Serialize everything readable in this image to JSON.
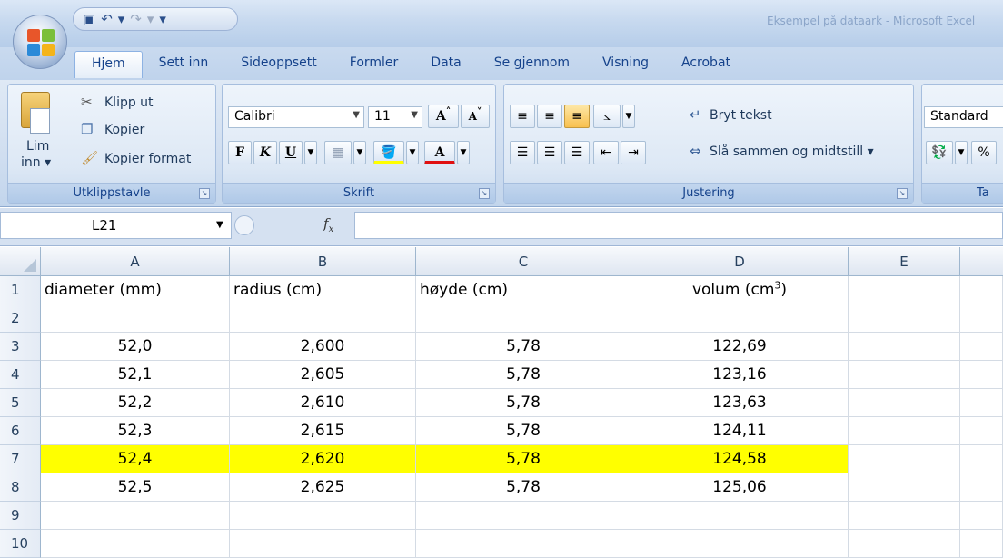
{
  "qat": {
    "undo_icon": "↶",
    "redo_icon": "↷",
    "dropdown": "▾"
  },
  "title_right": "Eksempel på dataark - Microsoft Excel",
  "tabs": [
    "Hjem",
    "Sett inn",
    "Sideoppsett",
    "Formler",
    "Data",
    "Se gjennom",
    "Visning",
    "Acrobat"
  ],
  "active_tab": "Hjem",
  "clipboard": {
    "paste_label": "Lim",
    "paste_label2": "inn ▾",
    "cut": "Klipp ut",
    "copy": "Kopier",
    "format_painter": "Kopier format",
    "group": "Utklippstavle"
  },
  "font": {
    "name": "Calibri",
    "size": "11",
    "grow": "A",
    "shrink": "A",
    "bold": "F",
    "italic": "K",
    "underline": "U",
    "font_color": "A",
    "group": "Skrift"
  },
  "alignment": {
    "wrap": "Bryt tekst",
    "merge": "Slå sammen og midtstill ▾",
    "group": "Justering"
  },
  "number": {
    "format": "Standard",
    "percent": "%",
    "group": "Ta"
  },
  "formula_bar": {
    "name_box": "L21",
    "fx": "fx",
    "formula": ""
  },
  "columns": [
    "A",
    "B",
    "C",
    "D",
    "E"
  ],
  "rows": [
    {
      "num": "1",
      "cells": [
        "diameter  (mm)",
        "radius  (cm)",
        "høyde (cm)",
        "",
        ""
      ],
      "header": true
    },
    {
      "num": "2",
      "cells": [
        "",
        "",
        "",
        "",
        ""
      ]
    },
    {
      "num": "3",
      "cells": [
        "52,0",
        "2,600",
        "5,78",
        "122,69",
        ""
      ]
    },
    {
      "num": "4",
      "cells": [
        "52,1",
        "2,605",
        "5,78",
        "123,16",
        ""
      ]
    },
    {
      "num": "5",
      "cells": [
        "52,2",
        "2,610",
        "5,78",
        "123,63",
        ""
      ]
    },
    {
      "num": "6",
      "cells": [
        "52,3",
        "2,615",
        "5,78",
        "124,11",
        ""
      ]
    },
    {
      "num": "7",
      "cells": [
        "52,4",
        "2,620",
        "5,78",
        "124,58",
        ""
      ],
      "highlight": true
    },
    {
      "num": "8",
      "cells": [
        "52,5",
        "2,625",
        "5,78",
        "125,06",
        ""
      ]
    },
    {
      "num": "9",
      "cells": [
        "",
        "",
        "",
        "",
        ""
      ]
    },
    {
      "num": "10",
      "cells": [
        "",
        "",
        "",
        "",
        ""
      ]
    }
  ],
  "volume_header": {
    "text": "volum (cm",
    "sup": "3",
    "close": ")"
  },
  "highlight_color": "#ffff00"
}
